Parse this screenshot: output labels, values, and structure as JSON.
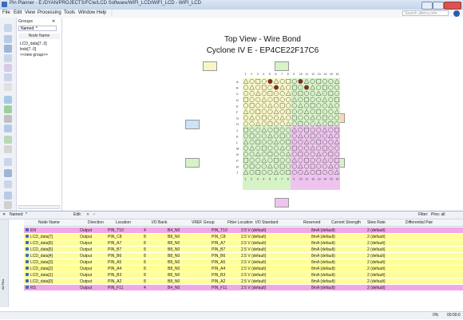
{
  "window": {
    "title": "Pin Planner - E:/DYAN/PROJECTS/FCIe/LCD Software/WIFI_LCD/WIFI_LCD - WIFI_LCD"
  },
  "menu": {
    "items": [
      "File",
      "Edit",
      "View",
      "Processing",
      "Tools",
      "Window",
      "Help"
    ],
    "search_placeholder": "Search altera.com"
  },
  "groups_panel": {
    "header": "Groups",
    "named_label": "Named:",
    "named_value": "*",
    "column": "Node Name",
    "items": [
      "LCD_data[7..0]",
      "leds[7..0]",
      "<<new group>>"
    ]
  },
  "view": {
    "title": "Top View - Wire Bond",
    "subtitle": "Cyclone IV E - EP4CE22F17C6",
    "row_letters": [
      "A",
      "B",
      "C",
      "D",
      "E",
      "F",
      "G",
      "H",
      "J",
      "K",
      "L",
      "M",
      "N",
      "P",
      "R",
      "T"
    ],
    "column_numbers": [
      "1",
      "2",
      "3",
      "4",
      "5",
      "6",
      "7",
      "8",
      "9",
      "10",
      "11",
      "12",
      "13",
      "14",
      "15",
      "16"
    ]
  },
  "bottom": {
    "named_label": "Named:",
    "named_value": "*",
    "edit_label": "Edit:",
    "filter_label": "Filter:",
    "filter_value": "Pins: all",
    "side_tab": "All Pins",
    "columns": [
      "Node Name",
      "Direction",
      "Location",
      "I/O Bank",
      "VREF Group",
      "Fitter Location",
      "I/O Standard",
      "Reserved",
      "Current Strength",
      "Slew Rate",
      "Differential Pair"
    ],
    "rows": [
      {
        "name": "EN",
        "dir": "Output",
        "loc": "PIN_T10",
        "bank": "4",
        "vref": "B4_N0",
        "fit": "PIN_T10",
        "std": "2.5 V (default)",
        "cur": "8mA (default)",
        "slew": "2 (default)",
        "style": "pink"
      },
      {
        "name": "LCD_data[7]",
        "dir": "Output",
        "loc": "PIN_C8",
        "bank": "8",
        "vref": "B8_N0",
        "fit": "PIN_C8",
        "std": "2.5 V (default)",
        "cur": "8mA (default)",
        "slew": "2 (default)",
        "style": "yellow"
      },
      {
        "name": "LCD_data[6]",
        "dir": "Output",
        "loc": "PIN_A7",
        "bank": "8",
        "vref": "B8_N0",
        "fit": "PIN_A7",
        "std": "2.5 V (default)",
        "cur": "8mA (default)",
        "slew": "2 (default)",
        "style": "yellow"
      },
      {
        "name": "LCD_data[5]",
        "dir": "Output",
        "loc": "PIN_B7",
        "bank": "8",
        "vref": "B8_N0",
        "fit": "PIN_B7",
        "std": "2.5 V (default)",
        "cur": "8mA (default)",
        "slew": "2 (default)",
        "style": "yellow"
      },
      {
        "name": "LCD_data[4]",
        "dir": "Output",
        "loc": "PIN_B6",
        "bank": "8",
        "vref": "B8_N0",
        "fit": "PIN_B6",
        "std": "2.5 V (default)",
        "cur": "8mA (default)",
        "slew": "2 (default)",
        "style": "yellow"
      },
      {
        "name": "LCD_data[3]",
        "dir": "Output",
        "loc": "PIN_A5",
        "bank": "8",
        "vref": "B8_N0",
        "fit": "PIN_A5",
        "std": "2.5 V (default)",
        "cur": "8mA (default)",
        "slew": "2 (default)",
        "style": "yellow"
      },
      {
        "name": "LCD_data[2]",
        "dir": "Output",
        "loc": "PIN_A4",
        "bank": "8",
        "vref": "B8_N0",
        "fit": "PIN_A4",
        "std": "2.5 V (default)",
        "cur": "8mA (default)",
        "slew": "2 (default)",
        "style": "yellow"
      },
      {
        "name": "LCD_data[1]",
        "dir": "Output",
        "loc": "PIN_B3",
        "bank": "8",
        "vref": "B8_N0",
        "fit": "PIN_B3",
        "std": "2.5 V (default)",
        "cur": "8mA (default)",
        "slew": "2 (default)",
        "style": "yellow"
      },
      {
        "name": "LCD_data[0]",
        "dir": "Output",
        "loc": "PIN_A2",
        "bank": "8",
        "vref": "B8_N0",
        "fit": "PIN_A2",
        "std": "2.5 V (default)",
        "cur": "8mA (default)",
        "slew": "2 (default)",
        "style": "yellow"
      },
      {
        "name": "RS",
        "dir": "Output",
        "loc": "PIN_F11",
        "bank": "4",
        "vref": "B4_N0",
        "fit": "PIN_F11",
        "std": "2.5 V (default)",
        "cur": "8mA (default)",
        "slew": "2 (default)",
        "style": "pink"
      }
    ]
  },
  "status": {
    "progress": "0%",
    "time": "00:00:0"
  }
}
